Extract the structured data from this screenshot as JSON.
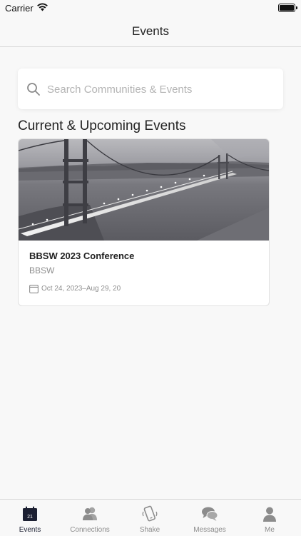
{
  "status_bar": {
    "carrier": "Carrier"
  },
  "header": {
    "title": "Events"
  },
  "search": {
    "placeholder": "Search Communities & Events",
    "value": ""
  },
  "section": {
    "title": "Current & Upcoming Events"
  },
  "events": [
    {
      "name": "BBSW 2023 Conference",
      "organizer": "BBSW",
      "dates": "Oct 24, 2023–Aug 29, 20"
    }
  ],
  "tabs": [
    {
      "label": "Events",
      "icon": "calendar-icon",
      "active": true,
      "badge_day": "21"
    },
    {
      "label": "Connections",
      "icon": "connections-icon",
      "active": false
    },
    {
      "label": "Shake",
      "icon": "shake-phone-icon",
      "active": false
    },
    {
      "label": "Messages",
      "icon": "messages-icon",
      "active": false
    },
    {
      "label": "Me",
      "icon": "person-icon",
      "active": false
    }
  ],
  "colors": {
    "accent": "#1c2032",
    "inactive": "#8c8c8c",
    "background": "#f8f8f8"
  }
}
